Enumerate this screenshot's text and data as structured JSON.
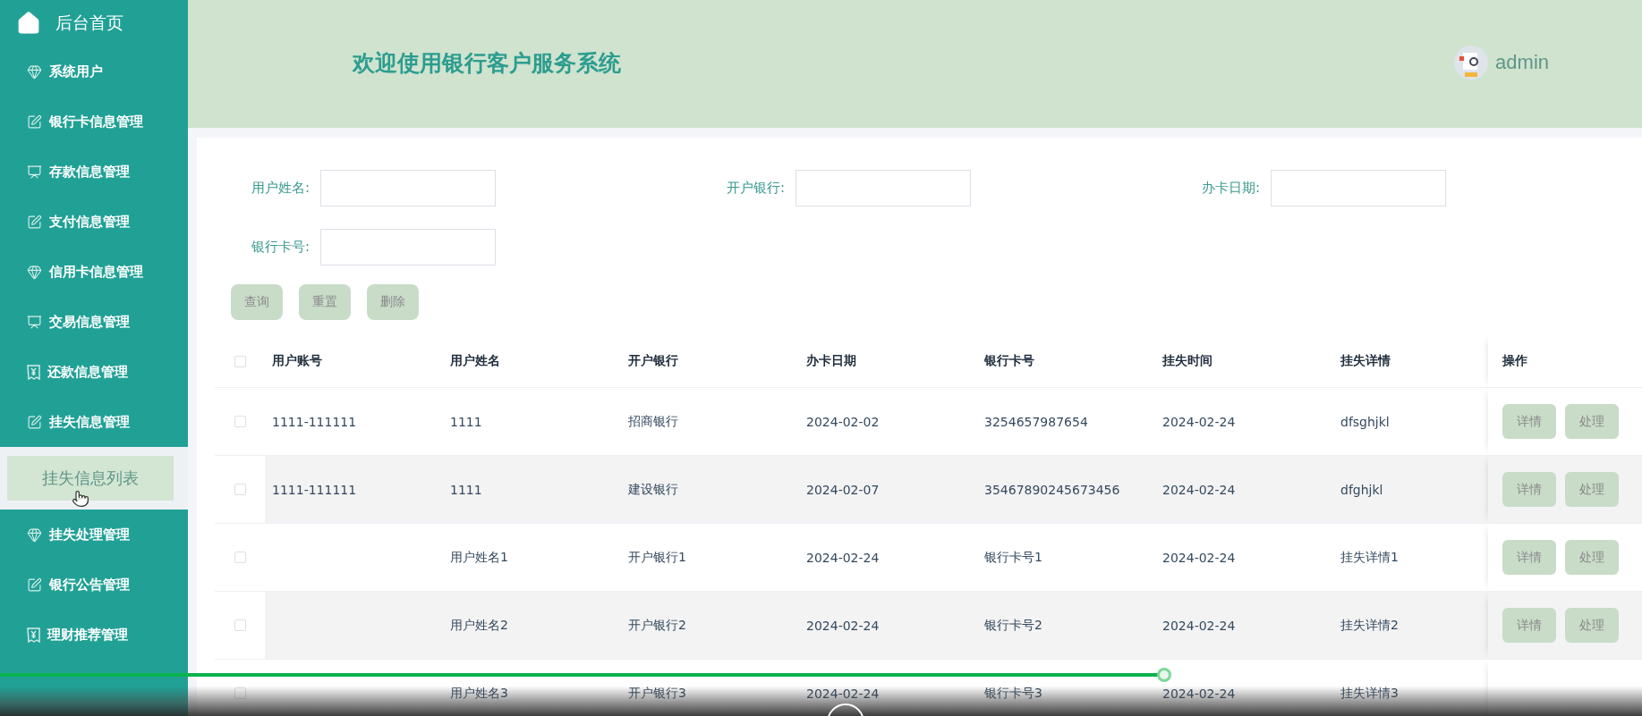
{
  "sidebar": {
    "home": {
      "label": "后台首页"
    },
    "items": [
      {
        "label": "系统用户",
        "kind": "diamond"
      },
      {
        "label": "银行卡信息管理",
        "kind": "edit"
      },
      {
        "label": "存款信息管理",
        "kind": "chart"
      },
      {
        "label": "支付信息管理",
        "kind": "edit"
      },
      {
        "label": "信用卡信息管理",
        "kind": "diamond"
      },
      {
        "label": "交易信息管理",
        "kind": "chart"
      },
      {
        "label": "还款信息管理",
        "kind": "yen"
      },
      {
        "label": "挂失信息管理",
        "kind": "edit",
        "children": [
          {
            "label": "挂失信息列表",
            "selected": true
          }
        ]
      },
      {
        "label": "挂失处理管理",
        "kind": "diamond"
      },
      {
        "label": "银行公告管理",
        "kind": "edit"
      },
      {
        "label": "理财推荐管理",
        "kind": "yen"
      }
    ]
  },
  "header": {
    "title": "欢迎使用银行客户服务系统",
    "user": "admin"
  },
  "search": {
    "fields": [
      {
        "label": "用户姓名:"
      },
      {
        "label": "开户银行:"
      },
      {
        "label": "办卡日期:"
      },
      {
        "label": "银行卡号:"
      }
    ],
    "buttons": [
      "查询",
      "重置",
      "删除"
    ]
  },
  "table": {
    "select_all": {
      "checked": false
    },
    "columns": [
      "用户账号",
      "用户姓名",
      "开户银行",
      "办卡日期",
      "银行卡号",
      "挂失时间",
      "挂失详情",
      "操作"
    ],
    "rows": [
      {
        "checked": false,
        "cells": [
          "1111-111111",
          "1111",
          "招商银行",
          "2024-02-02",
          "3254657987654",
          "2024-02-24",
          "dfsghjkl"
        ],
        "actions": [
          "详情",
          "处理"
        ]
      },
      {
        "checked": false,
        "cells": [
          "1111-111111",
          "1111",
          "建设银行",
          "2024-02-07",
          "35467890245673456",
          "2024-02-24",
          "dfghjkl"
        ],
        "actions": [
          "详情",
          "处理"
        ]
      },
      {
        "checked": false,
        "cells": [
          "",
          "用户姓名1",
          "开户银行1",
          "2024-02-24",
          "银行卡号1",
          "2024-02-24",
          "挂失详情1"
        ],
        "actions": [
          "详情",
          "处理"
        ]
      },
      {
        "checked": false,
        "cells": [
          "",
          "用户姓名2",
          "开户银行2",
          "2024-02-24",
          "银行卡号2",
          "2024-02-24",
          "挂失详情2"
        ],
        "actions": [
          "详情",
          "处理"
        ]
      },
      {
        "checked": false,
        "cells": [
          "",
          "用户姓名3",
          "开户银行3",
          "2024-02-24",
          "银行卡号3",
          "2024-02-24",
          "挂失详情3"
        ],
        "actions": []
      }
    ]
  },
  "player": {
    "progress": {
      "level": 0.709
    }
  }
}
